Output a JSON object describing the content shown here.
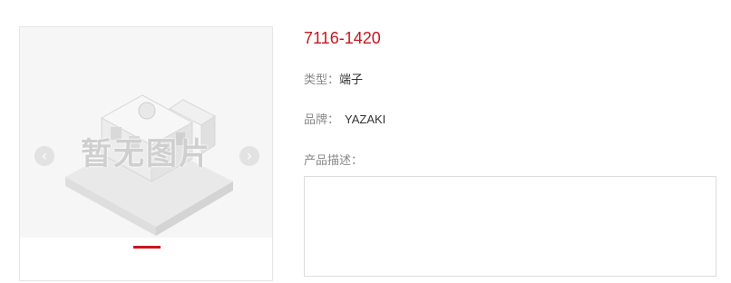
{
  "gallery": {
    "placeholder_text": "暂无图片",
    "prev_icon": "‹",
    "next_icon": "›",
    "slide_count": 1,
    "active_slide": 1,
    "accent_color": "#c8161d"
  },
  "product": {
    "title": "7116-1420",
    "type_label": "类型：",
    "type_value": "端子",
    "brand_label": "品牌：",
    "brand_value": "YAZAKI",
    "description_label": "产品描述：",
    "description_value": ""
  }
}
